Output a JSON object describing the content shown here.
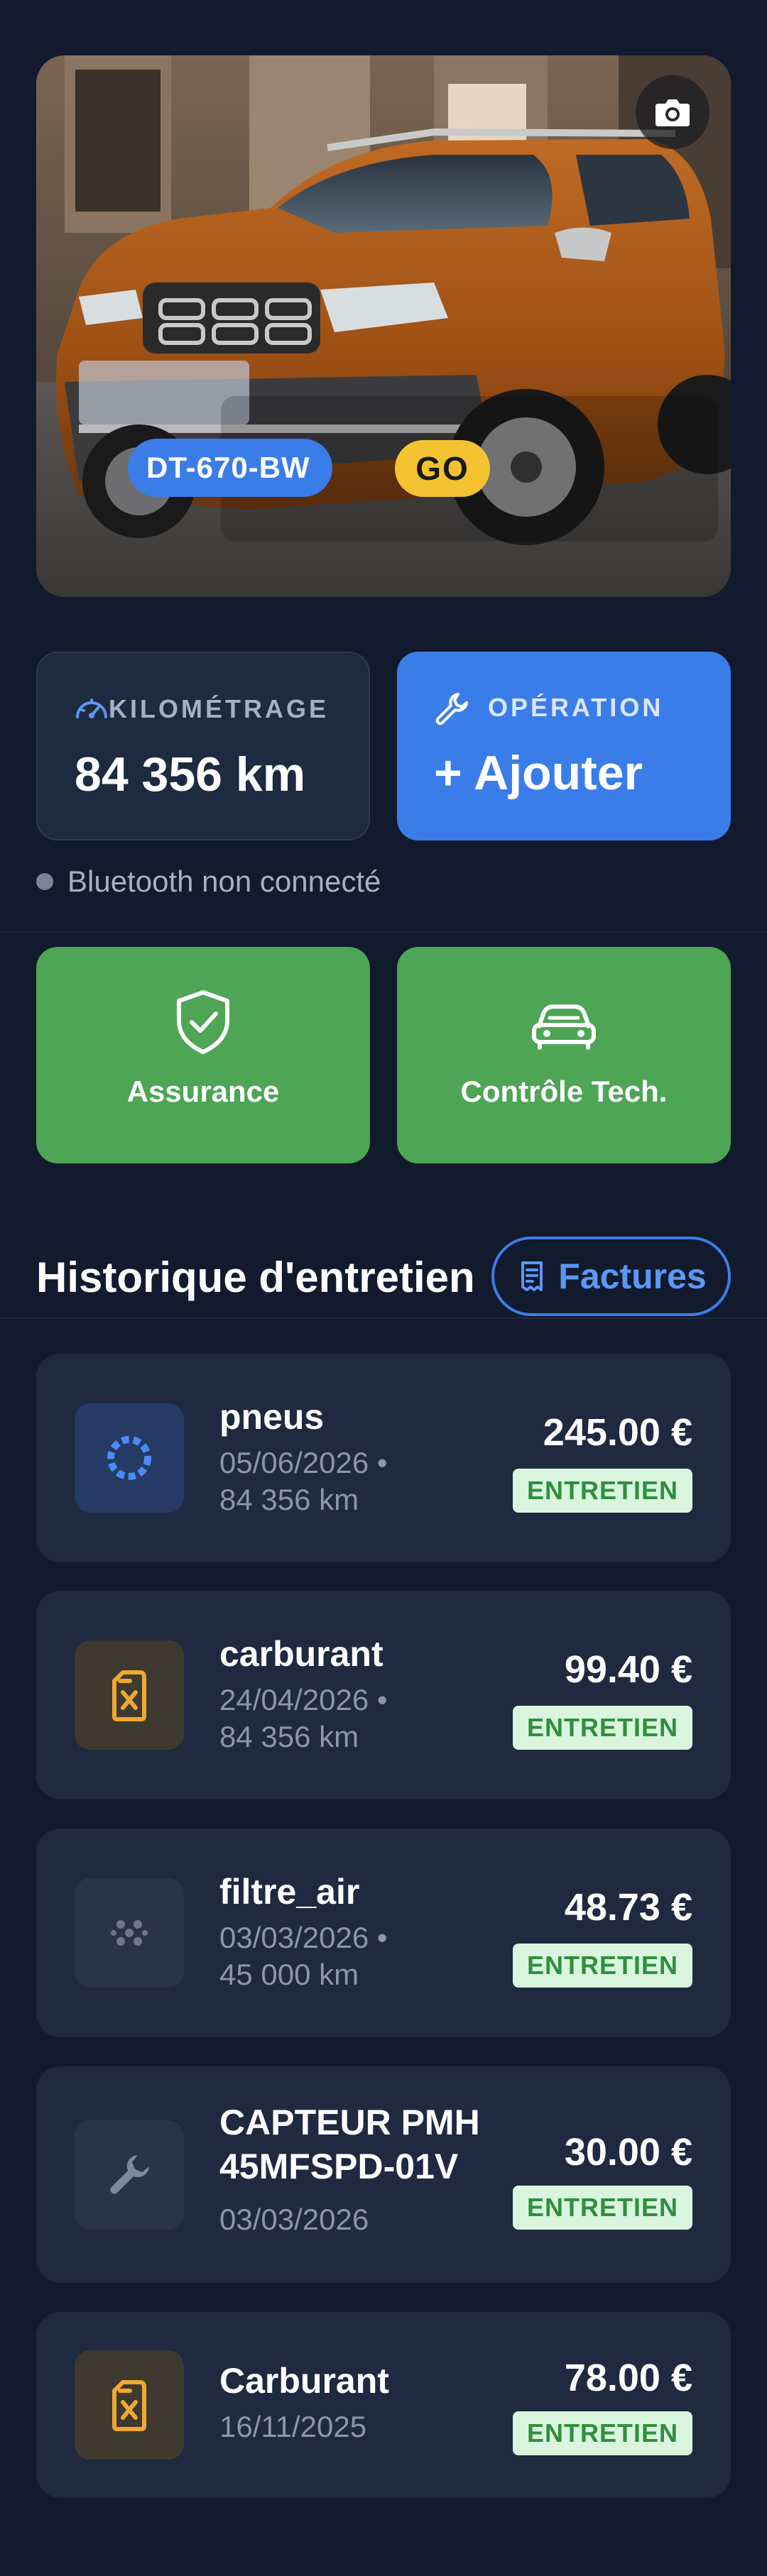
{
  "vehicle": {
    "plate": "DT-670-BW",
    "go_label": "GO",
    "photo_alt": "Dacia Duster orange"
  },
  "stats": {
    "mileage_label": "KILOMÉTRAGE",
    "mileage_value": "84 356 km",
    "operation_label": "OPÉRATION",
    "operation_action": "+ Ajouter"
  },
  "bluetooth": {
    "status": "Bluetooth non connecté"
  },
  "tiles": {
    "insurance_label": "Assurance",
    "inspection_label": "Contrôle Tech."
  },
  "history": {
    "title": "Historique d'entretien",
    "invoices_label": "Factures",
    "entries": [
      {
        "name": "pneus",
        "date": "05/06/2026 •",
        "km": "84 356 km",
        "price": "245.00 €",
        "tag": "ENTRETIEN",
        "icon": "tire-icon"
      },
      {
        "name": "carburant",
        "date": "24/04/2026 •",
        "km": "84 356 km",
        "price": "99.40 €",
        "tag": "ENTRETIEN",
        "icon": "fuel-can-icon"
      },
      {
        "name": "filtre_air",
        "date": "03/03/2026 •",
        "km": "45 000 km",
        "price": "48.73 €",
        "tag": "ENTRETIEN",
        "icon": "air-filter-icon"
      },
      {
        "name_line1": "CAPTEUR PMH",
        "name_line2": "45MFSPD-01V",
        "date": "03/03/2026",
        "price": "30.00 €",
        "tag": "ENTRETIEN",
        "icon": "wrench-icon"
      },
      {
        "name": "Carburant",
        "date": "16/11/2025",
        "price": "78.00 €",
        "tag": "ENTRETIEN",
        "icon": "fuel-can-icon"
      }
    ]
  },
  "colors": {
    "background": "#121a2e",
    "card": "#1f2940",
    "accent_blue": "#3b7de8",
    "green": "#4ea555",
    "go_yellow": "#f2c230",
    "badge_bg": "#d9f5dd",
    "badge_text": "#2f8f3f"
  }
}
